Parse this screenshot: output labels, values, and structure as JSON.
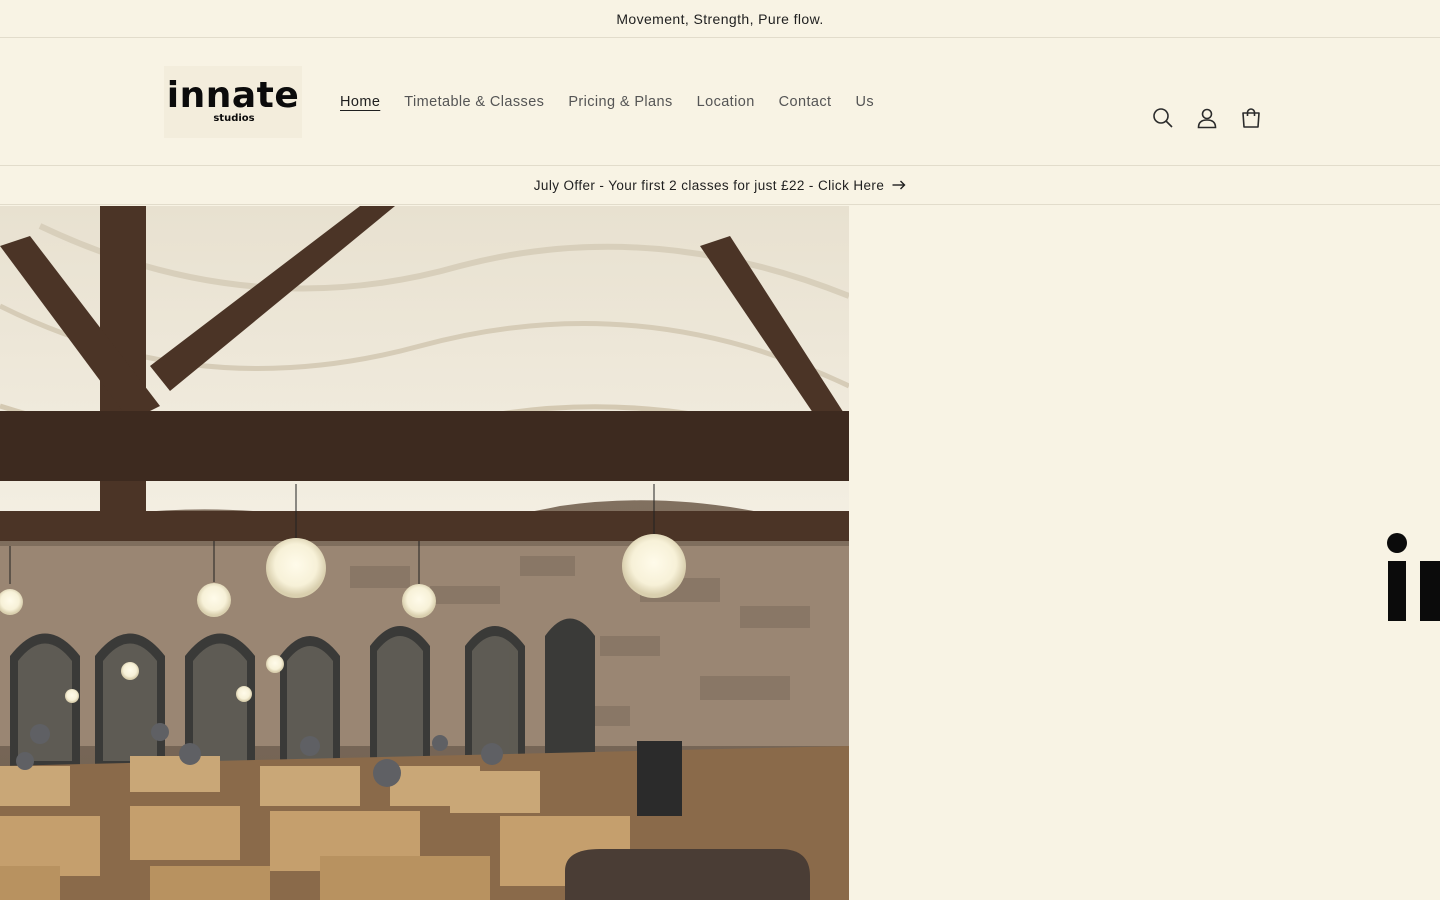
{
  "announcement": {
    "text": "Movement, Strength, Pure flow."
  },
  "header": {
    "logo": {
      "word": "innate",
      "sub": "studios"
    },
    "nav": [
      {
        "label": "Home",
        "active": true
      },
      {
        "label": "Timetable & Classes"
      },
      {
        "label": "Pricing & Plans"
      },
      {
        "label": "Location"
      },
      {
        "label": "Contact"
      },
      {
        "label": "Us"
      }
    ],
    "icons": [
      "search-icon",
      "account-icon",
      "cart-icon"
    ]
  },
  "offer": {
    "text": "July Offer - Your first 2 classes for just £22 - Click Here",
    "icon": "arrow-right-icon"
  },
  "hero": {
    "image_alt": "Pilates studio with reformer machines, stone walls, wooden beams and draped fabric ceiling",
    "logo_fragment": "i"
  },
  "colors": {
    "background": "#f8f3e4",
    "text": "#1f1f1f",
    "border": "#e2dccb"
  }
}
